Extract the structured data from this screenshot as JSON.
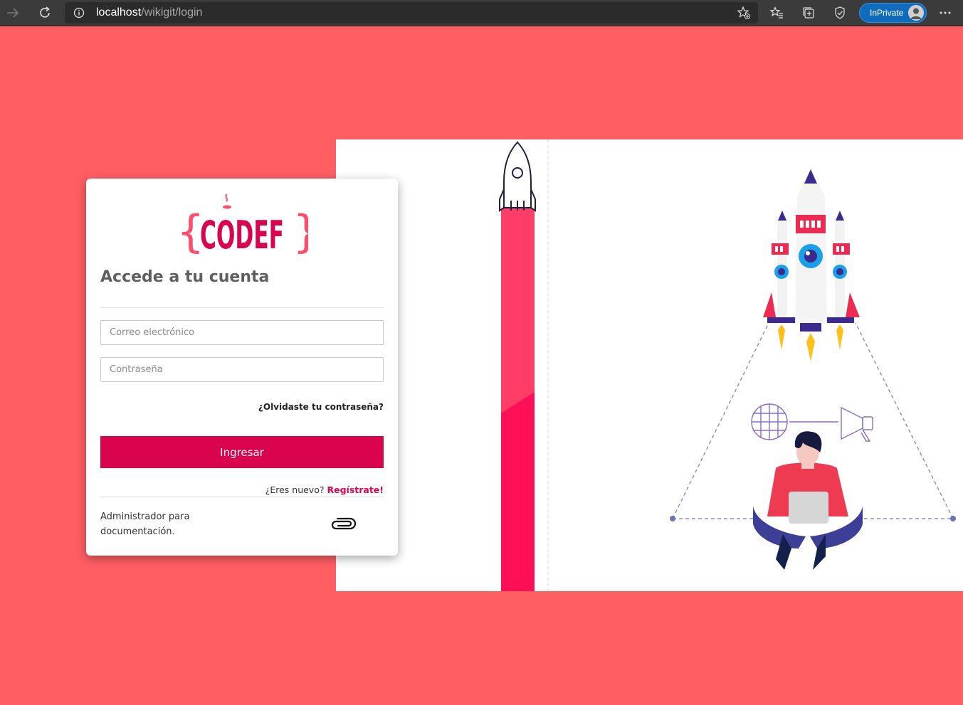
{
  "browser": {
    "url_host": "localhost",
    "url_path": "/wikigit/login",
    "inprivate_label": "InPrivate",
    "icons": [
      "forward-icon",
      "refresh-icon",
      "info-icon",
      "add-favorite-icon",
      "favorites-icon",
      "collections-icon",
      "browser-essentials-icon",
      "profile-avatar-icon",
      "more-icon"
    ]
  },
  "login": {
    "logo_text": "CODEF",
    "title": "Accede a tu cuenta",
    "email_placeholder": "Correo electrónico",
    "password_placeholder": "Contraseña",
    "forgot_password": "¿Olvidaste tu contraseña?",
    "submit_label": "Ingresar",
    "new_user_prompt": "¿Eres nuevo?",
    "register_link": "Regístrate!",
    "admin_text": "Administrador para documentación.",
    "admin_icon": "paperclip-icon"
  },
  "colors": {
    "background": "#ff5e63",
    "accent": "#d9044d",
    "title_gray": "#5f5f5f"
  }
}
